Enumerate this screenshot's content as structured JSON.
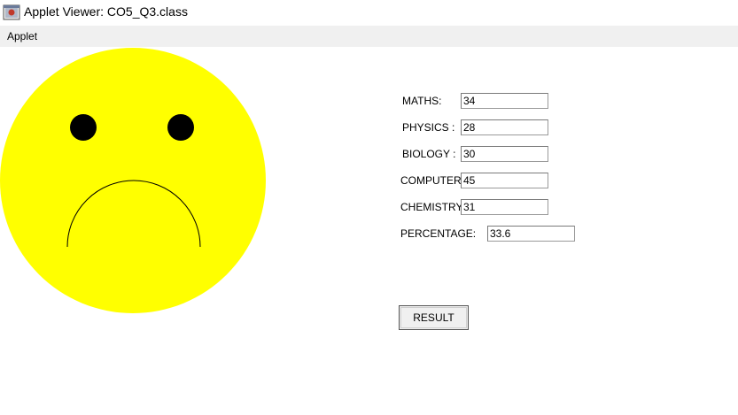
{
  "window": {
    "title": "Applet Viewer: CO5_Q3.class",
    "icon": "java-applet-icon"
  },
  "menubar": {
    "items": [
      {
        "label": "Applet"
      }
    ]
  },
  "face": {
    "icon": "sad-face-icon",
    "color": "#ffff00",
    "feature_color": "#000000"
  },
  "form": {
    "fields": [
      {
        "label": "MATHS:",
        "value": "34"
      },
      {
        "label": "PHYSICS :",
        "value": "28"
      },
      {
        "label": "BIOLOGY :",
        "value": "30"
      },
      {
        "label": "COMPUTER",
        "value": "45"
      },
      {
        "label": "CHEMISTRY",
        "value": "31"
      }
    ],
    "percentage": {
      "label": "PERCENTAGE:",
      "value": "33.6"
    },
    "result_button": "RESULT"
  }
}
